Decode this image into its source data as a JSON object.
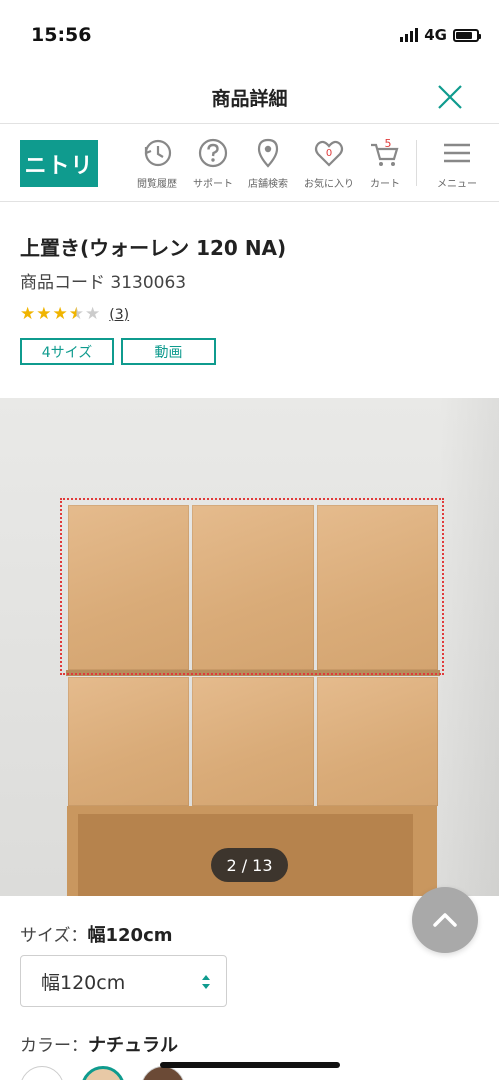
{
  "status": {
    "time": "15:56",
    "network": "4G",
    "battery_level": 0.8
  },
  "title_bar": {
    "title": "商品詳細"
  },
  "header": {
    "logo_text": "ニトリ",
    "nav": [
      {
        "label": "閲覧履歴",
        "icon": "history-icon"
      },
      {
        "label": "サポート",
        "icon": "help-icon"
      },
      {
        "label": "店舗検索",
        "icon": "location-pin-icon"
      },
      {
        "label": "お気に入り",
        "icon": "heart-icon",
        "badge": "0"
      },
      {
        "label": "カート",
        "icon": "cart-icon",
        "badge": "5"
      },
      {
        "label": "メニュー",
        "icon": "hamburger-menu-icon"
      }
    ]
  },
  "product": {
    "name": "上置き(ウォーレン 120 NA)",
    "code": "商品コード 3130063",
    "rating": 3.5,
    "review_count": "(3)",
    "tags": [
      "4サイズ",
      "動画"
    ]
  },
  "gallery": {
    "counter": "2 / 13"
  },
  "options": {
    "size_label": "サイズ：",
    "size_value": "幅120cm",
    "size_selected": "幅120cm",
    "color_label": "カラー：",
    "color_value": "ナチュラル",
    "swatches": [
      "#ffffff",
      "#e8c9a6",
      "#6b4a36"
    ]
  },
  "colors": {
    "brand": "#0f9b8e",
    "star": "#f0b400",
    "badge": "#e03a3a"
  }
}
